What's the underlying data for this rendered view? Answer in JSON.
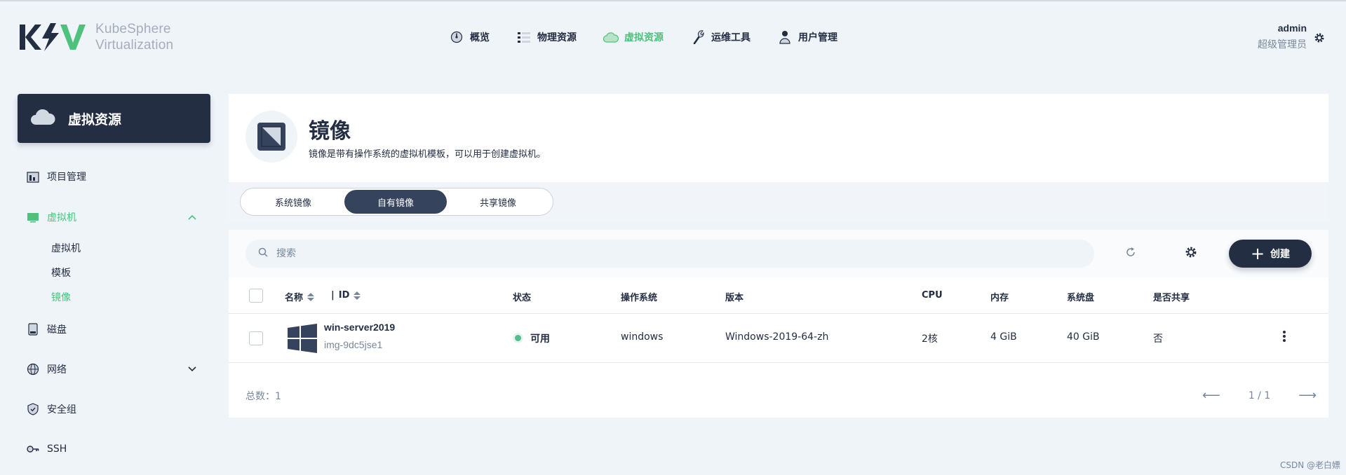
{
  "brand": {
    "logo_text": "KSV",
    "name_line1": "KubeSphere",
    "name_line2": "Virtualization"
  },
  "nav": [
    {
      "label": "概览",
      "icon": "dashboard-icon"
    },
    {
      "label": "物理资源",
      "icon": "list-icon"
    },
    {
      "label": "虚拟资源",
      "icon": "cloud-icon",
      "active": true
    },
    {
      "label": "运维工具",
      "icon": "wrench-icon"
    },
    {
      "label": "用户管理",
      "icon": "user-icon"
    }
  ],
  "user": {
    "name": "admin",
    "role": "超级管理员"
  },
  "sidebar": {
    "title": "虚拟资源",
    "items": [
      {
        "label": "项目管理"
      },
      {
        "label": "虚拟机"
      },
      {
        "label": "磁盘"
      },
      {
        "label": "网络"
      },
      {
        "label": "安全组"
      },
      {
        "label": "SSH"
      }
    ],
    "vm_sub": [
      "虚拟机",
      "模板",
      "镜像"
    ]
  },
  "page": {
    "title": "镜像",
    "description": "镜像是带有操作系统的虚拟机模板，可以用于创建虚拟机。"
  },
  "tabs": [
    {
      "label": "系统镜像"
    },
    {
      "label": "自有镜像",
      "active": true
    },
    {
      "label": "共享镜像"
    }
  ],
  "toolbar": {
    "search_placeholder": "搜索",
    "create_label": "创建"
  },
  "table": {
    "columns": {
      "name": "名称",
      "id": "ID",
      "status": "状态",
      "os": "操作系统",
      "version": "版本",
      "cpu": "CPU",
      "memory": "内存",
      "disk": "系统盘",
      "shared": "是否共享"
    },
    "rows": [
      {
        "name": "win-server2019",
        "id": "img-9dc5jse1",
        "status": "可用",
        "os": "windows",
        "version": "Windows-2019-64-zh",
        "cpu": "2核",
        "memory": "4 GiB",
        "disk": "40 GiB",
        "shared": "否"
      }
    ]
  },
  "footer": {
    "total": "总数：1",
    "page": "1 / 1"
  },
  "watermark": "CSDN @老白嫖",
  "colors": {
    "accent": "#4ec27d",
    "dark": "#242e42",
    "status_ok": "#55bc8a",
    "bg": "#eff4f9"
  }
}
